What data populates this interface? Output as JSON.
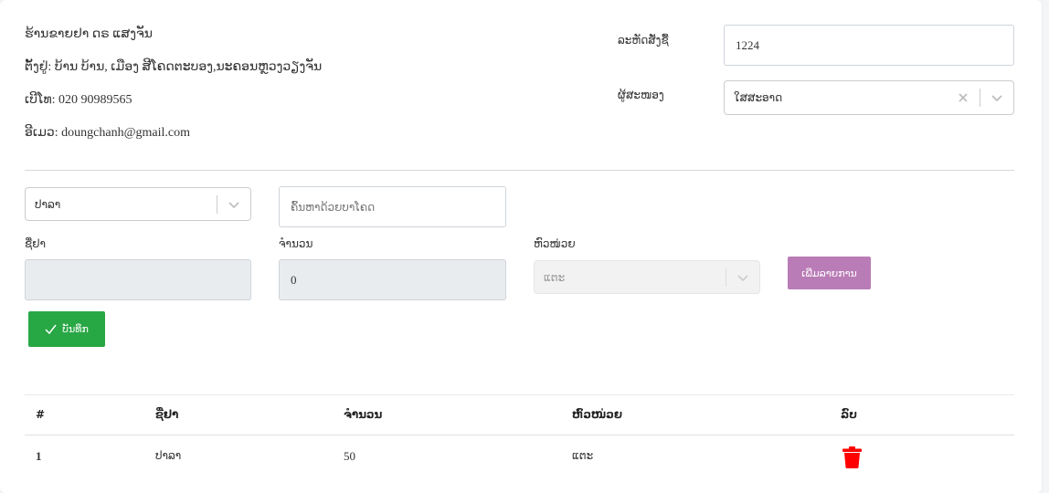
{
  "shop": {
    "name": "ຮ້ານຂາຍຢາ ດຣ ແສງຈັນ",
    "address": "ຕັ້ງຢູ່: ບ້ານ ບ້ານ, ເມືອງ ສີໂຄດຕະບອງ,ນະຄອນຫຼວງວຽງຈັນ",
    "phone": "ເບີໂທ: 020 90989565",
    "email": "ອີເມວ: doungchanh@gmail.com"
  },
  "form_top": {
    "code_label": "ລະຫັດສັ່ງຊື້",
    "code_value": "1224",
    "seller_label": "ຜູ້ສະໜອງ",
    "seller_value": "ໃສສະອາດ"
  },
  "item_form": {
    "category_value": "ປາລາ",
    "barcode_placeholder": "ຄົ້ນຫາດ້ວຍບາໂຄດ",
    "name_label": "ຊື່ຢາ",
    "qty_label": "ຈຳນວນ",
    "qty_value": "0",
    "unit_label": "ຫົວໜ່ວຍ",
    "unit_value": "ແຕະ",
    "add_button": "ເພີ່ມລາຍການ",
    "save_button": "ບັນທຶກ"
  },
  "table": {
    "headers": [
      "#",
      "ຊື່ຢາ",
      "ຈຳນວນ",
      "ຫົວໜ່ວຍ",
      "ລົບ"
    ],
    "rows": [
      [
        "1",
        "ປາລາ",
        "50",
        "ແຕະ"
      ]
    ]
  },
  "colors": {
    "add_button": "#b97cb6",
    "save_button": "#28a745",
    "delete_icon": "#ff0000"
  }
}
